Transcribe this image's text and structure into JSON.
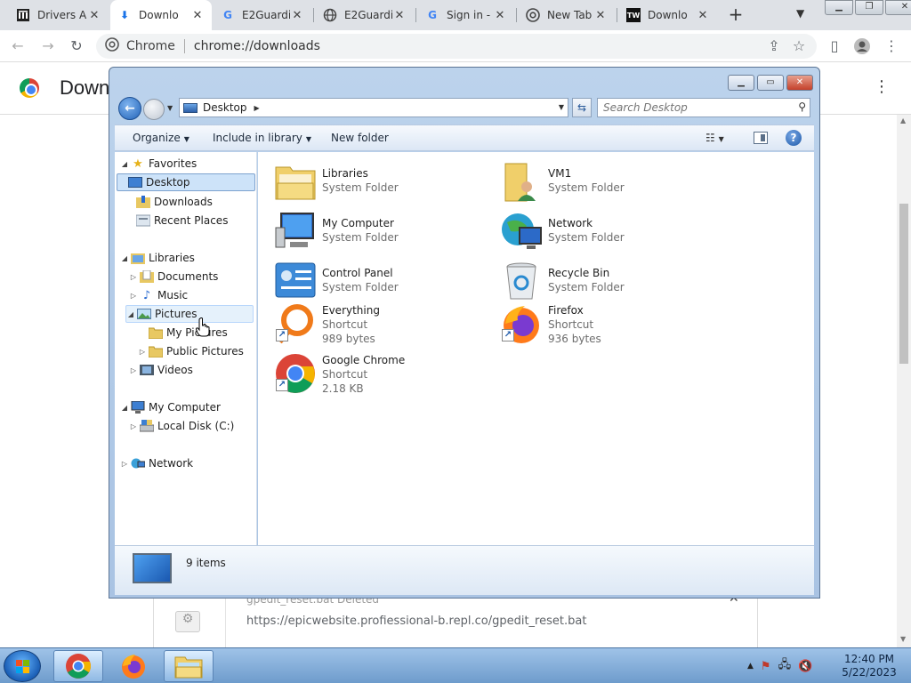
{
  "browser": {
    "tabs": [
      {
        "title": "Drivers A",
        "icon": "bank-icon"
      },
      {
        "title": "Downlo",
        "icon": "download-icon",
        "active": true
      },
      {
        "title": "E2Guardi",
        "icon": "google-icon"
      },
      {
        "title": "E2Guardi",
        "icon": "globe-icon"
      },
      {
        "title": "Sign in -",
        "icon": "google-icon"
      },
      {
        "title": "New Tab",
        "icon": "chrome-icon"
      },
      {
        "title": "Downlo",
        "icon": "tw-icon"
      }
    ],
    "omnibox": {
      "site_label": "Chrome",
      "url": "chrome://downloads"
    }
  },
  "downloads_page": {
    "title": "Down",
    "item": {
      "filename": "gpedit_reset.bat",
      "status": "Deleted",
      "url": "https://epicwebsite.profiessional-b.repl.co/gpedit_reset.bat"
    }
  },
  "explorer": {
    "address": "Desktop",
    "search_placeholder": "Search Desktop",
    "commands": {
      "organize": "Organize",
      "include": "Include in library",
      "new_folder": "New folder"
    },
    "nav": {
      "favorites": "Favorites",
      "desktop": "Desktop",
      "downloads": "Downloads",
      "recent": "Recent Places",
      "libraries": "Libraries",
      "documents": "Documents",
      "music": "Music",
      "pictures": "Pictures",
      "my_pictures": "My Pictures",
      "public_pictures": "Public Pictures",
      "videos": "Videos",
      "my_computer": "My Computer",
      "local_disk": "Local Disk (C:)",
      "network": "Network"
    },
    "items": [
      {
        "name": "Libraries",
        "type": "System Folder"
      },
      {
        "name": "VM1",
        "type": "System Folder"
      },
      {
        "name": "My Computer",
        "type": "System Folder"
      },
      {
        "name": "Network",
        "type": "System Folder"
      },
      {
        "name": "Control Panel",
        "type": "System Folder"
      },
      {
        "name": "Recycle Bin",
        "type": "System Folder"
      },
      {
        "name": "Everything",
        "type": "Shortcut",
        "size": "989 bytes"
      },
      {
        "name": "Firefox",
        "type": "Shortcut",
        "size": "936 bytes"
      },
      {
        "name": "Google Chrome",
        "type": "Shortcut",
        "size": "2.18 KB"
      }
    ],
    "status": "9 items"
  },
  "taskbar": {
    "time": "12:40 PM",
    "date": "5/22/2023"
  }
}
